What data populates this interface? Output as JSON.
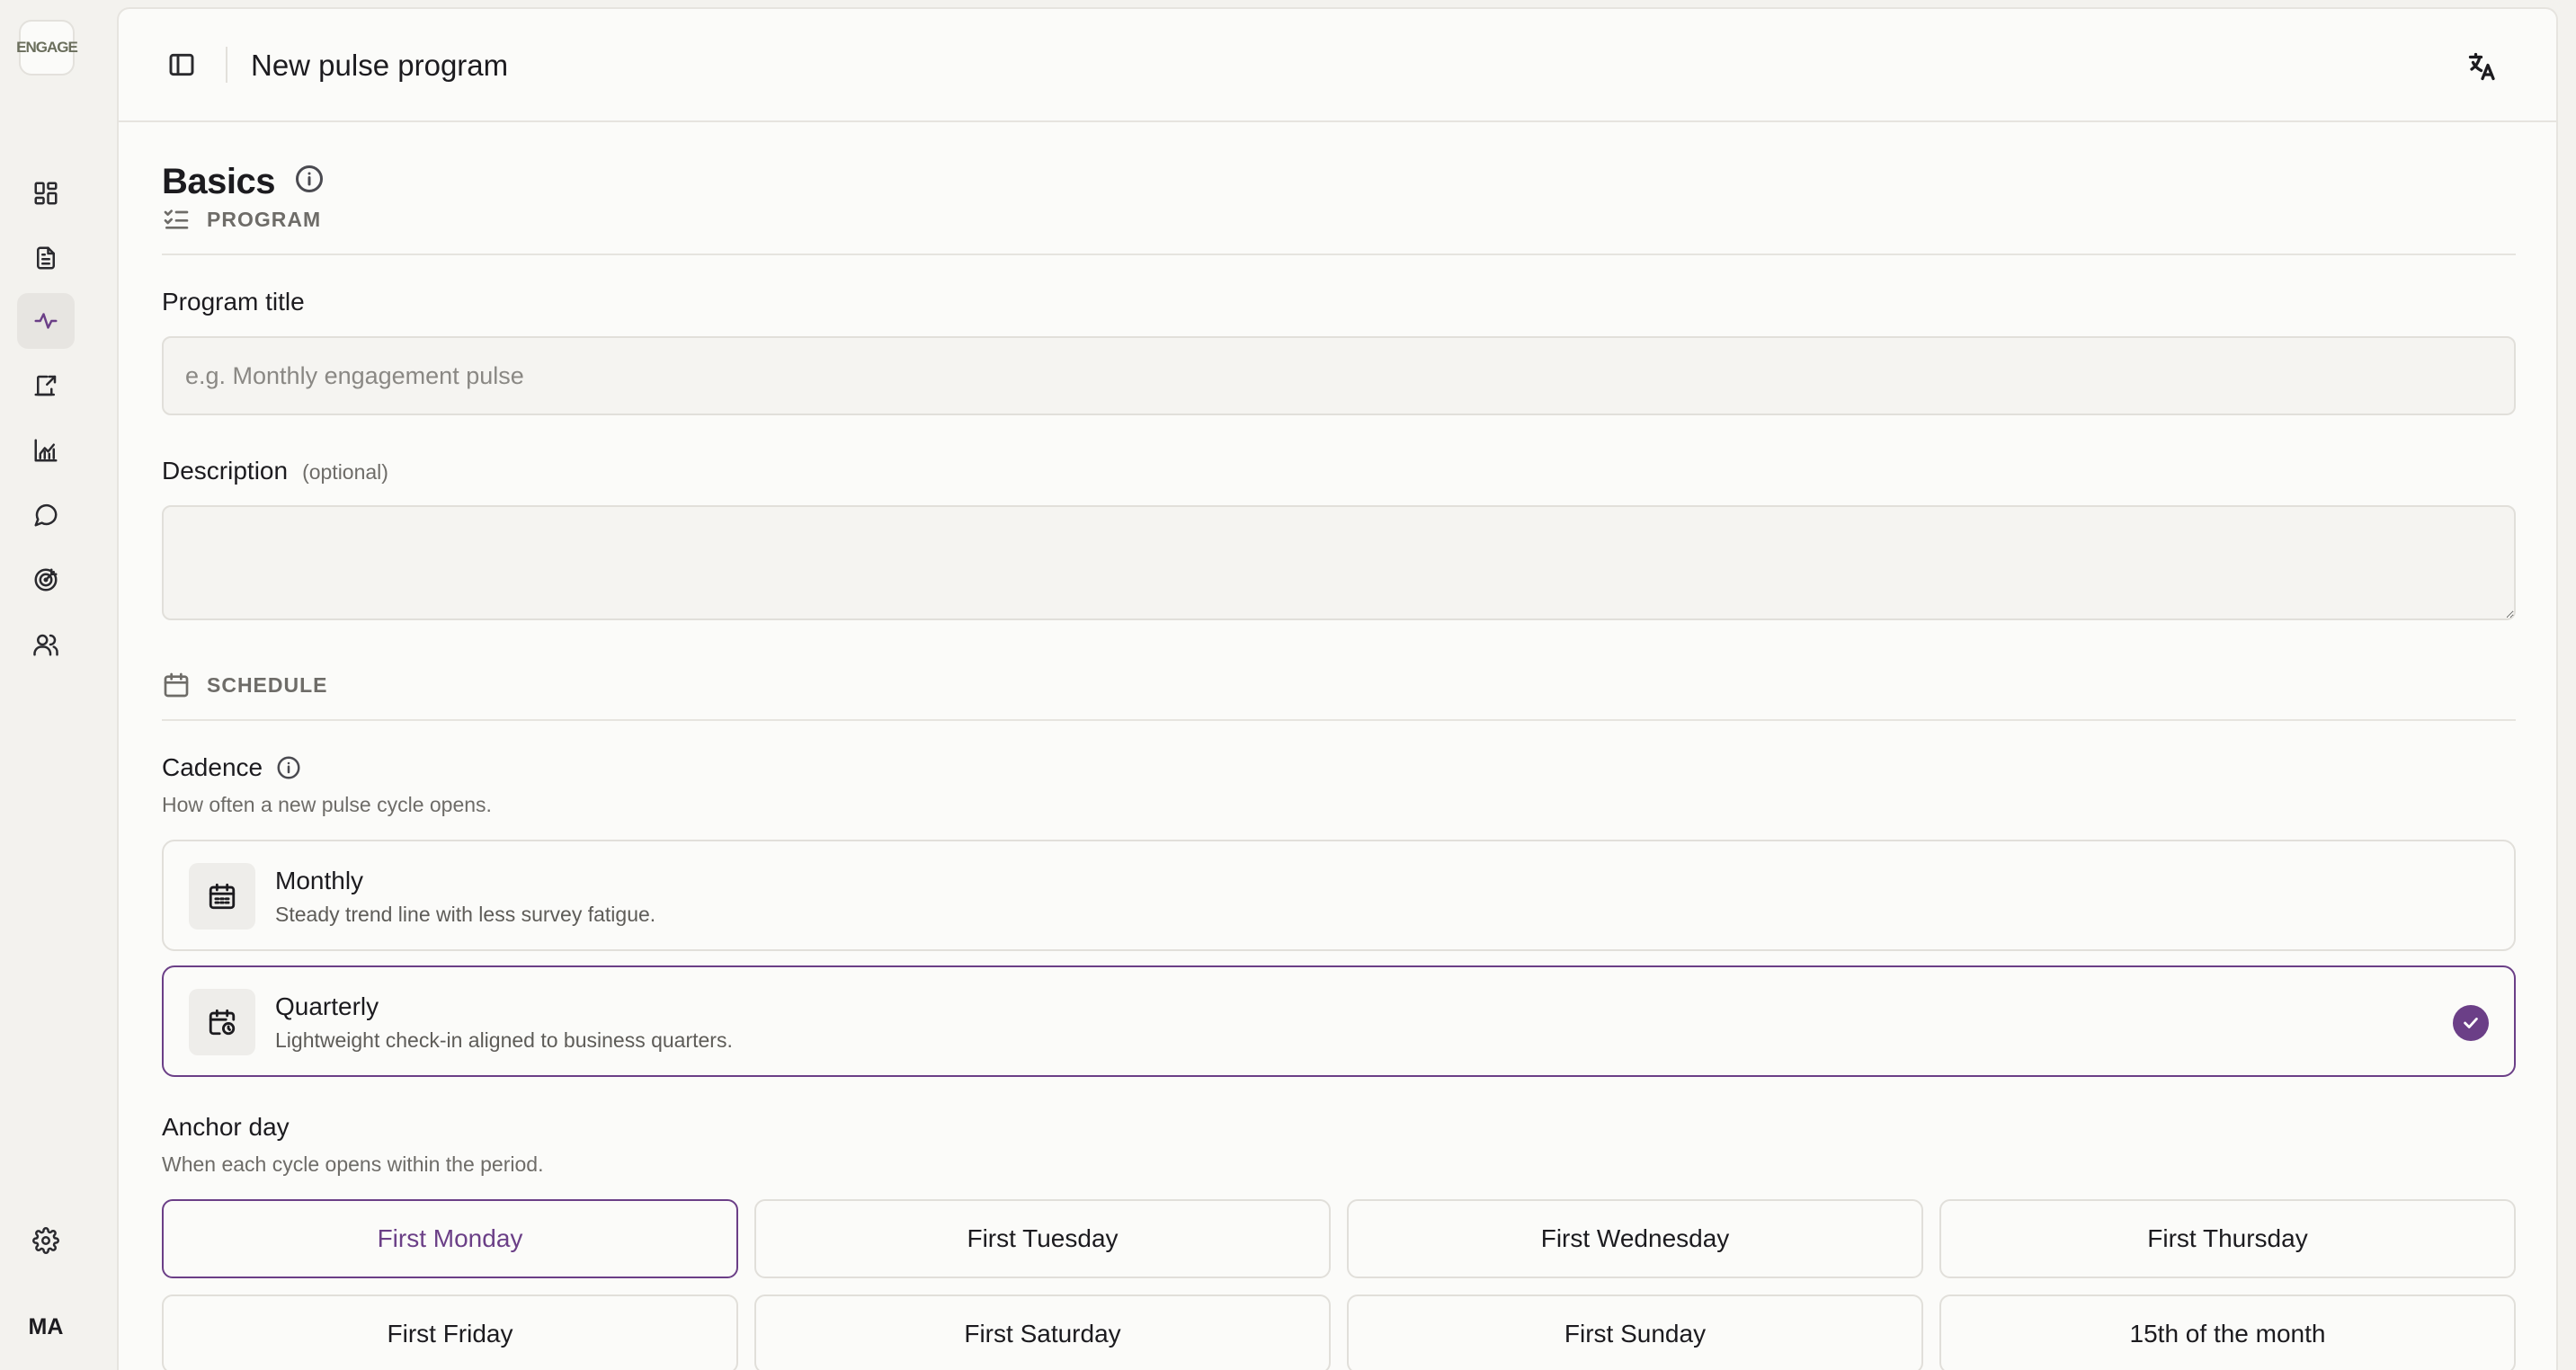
{
  "app": {
    "logo_text": "ENGAGE",
    "user_initials": "MA"
  },
  "sidebar": {
    "items": [
      {
        "name": "dashboard",
        "icon": "layout-dashboard-icon",
        "active": false
      },
      {
        "name": "surveys",
        "icon": "file-text-icon",
        "active": false
      },
      {
        "name": "pulse",
        "icon": "activity-icon",
        "active": true
      },
      {
        "name": "actions",
        "icon": "clipboard-share-icon",
        "active": false
      },
      {
        "name": "analytics",
        "icon": "chart-line-icon",
        "active": false
      },
      {
        "name": "feedback",
        "icon": "message-circle-icon",
        "active": false
      },
      {
        "name": "goals",
        "icon": "target-icon",
        "active": false
      },
      {
        "name": "people",
        "icon": "users-icon",
        "active": false
      }
    ],
    "settings_icon": "settings-icon"
  },
  "header": {
    "title": "New pulse program",
    "translate_icon": "languages-icon"
  },
  "basics": {
    "title": "Basics",
    "program_group": "PROGRAM",
    "program_title_label": "Program title",
    "program_title_placeholder": "e.g. Monthly engagement pulse",
    "program_title_value": "",
    "description_label": "Description",
    "description_optional": "(optional)",
    "description_value": ""
  },
  "schedule": {
    "group": "SCHEDULE",
    "cadence_label": "Cadence",
    "cadence_helper": "How often a new pulse cycle opens.",
    "cadence_options": [
      {
        "title": "Monthly",
        "desc": "Steady trend line with less survey fatigue.",
        "selected": false
      },
      {
        "title": "Quarterly",
        "desc": "Lightweight check-in aligned to business quarters.",
        "selected": true
      }
    ],
    "anchor_label": "Anchor day",
    "anchor_helper": "When each cycle opens within the period.",
    "anchor_days": [
      "First Monday",
      "First Tuesday",
      "First Wednesday",
      "First Thursday",
      "First Friday",
      "First Saturday",
      "First Sunday",
      "15th of the month"
    ],
    "anchor_selected": "First Monday"
  },
  "colors": {
    "accent": "#6b3f87",
    "border": "#e1dfda",
    "background": "#f3f2ee"
  }
}
